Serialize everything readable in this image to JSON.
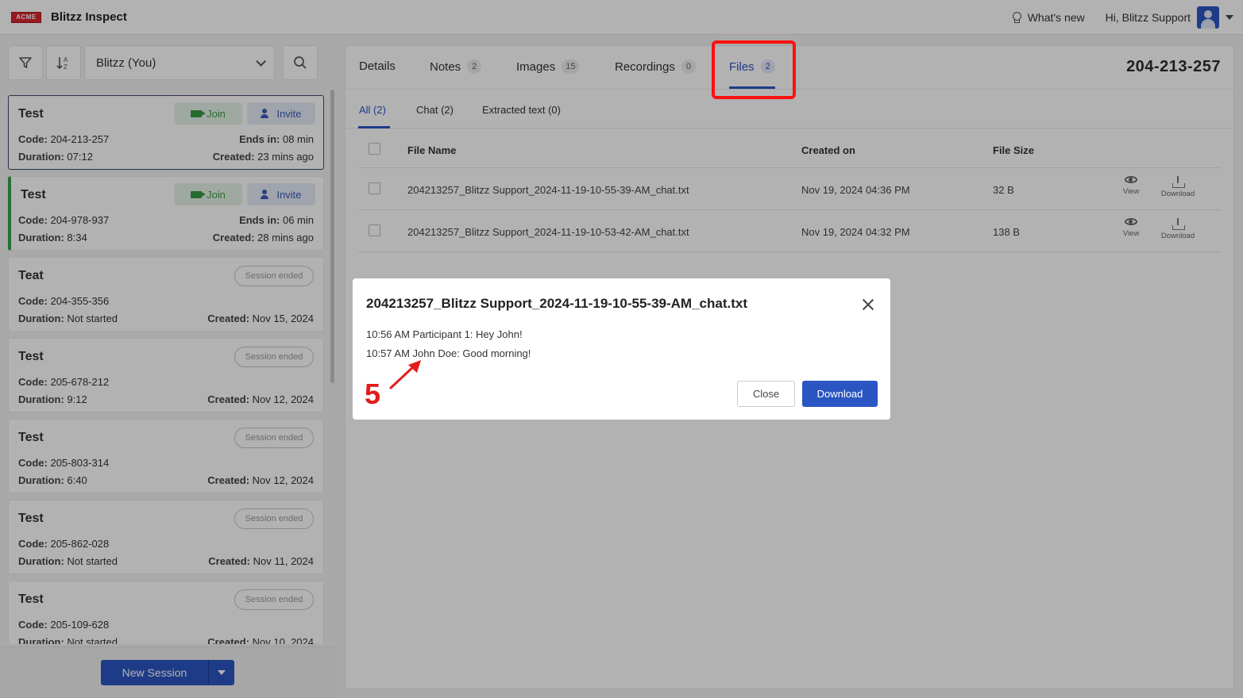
{
  "app": {
    "logo_text": "ACME",
    "title": "Blitzz Inspect",
    "whats_new": "What's new",
    "greeting": "Hi, Blitzz Support"
  },
  "sidebar": {
    "owner_filter": "Blitzz (You)",
    "sessions": [
      {
        "title": "Test",
        "code": "204-213-257",
        "duration": "07:12",
        "ends_in": "08 min",
        "created": "23 mins ago",
        "join": "Join",
        "invite": "Invite"
      },
      {
        "title": "Test",
        "code": "204-978-937",
        "duration": "8:34",
        "ends_in": "06 min",
        "created": "28 mins ago",
        "join": "Join",
        "invite": "Invite"
      },
      {
        "title": "Teat",
        "code": "204-355-356",
        "duration": "Not started",
        "created": "Nov 15, 2024",
        "status": "Session ended"
      },
      {
        "title": "Test",
        "code": "205-678-212",
        "duration": "9:12",
        "created": "Nov 12, 2024",
        "status": "Session ended"
      },
      {
        "title": "Test",
        "code": "205-803-314",
        "duration": "6:40",
        "created": "Nov 12, 2024",
        "status": "Session ended"
      },
      {
        "title": "Test",
        "code": "205-862-028",
        "duration": "Not started",
        "created": "Nov 11, 2024",
        "status": "Session ended"
      },
      {
        "title": "Test",
        "code": "205-109-628",
        "duration": "Not started",
        "created": "Nov 10, 2024",
        "status": "Session ended"
      }
    ],
    "labels": {
      "code": "Code:",
      "duration": "Duration:",
      "ends_in": "Ends in:",
      "created": "Created:"
    },
    "new_session": "New Session"
  },
  "main": {
    "tabs": [
      {
        "label": "Details"
      },
      {
        "label": "Notes",
        "count": "2"
      },
      {
        "label": "Images",
        "count": "15"
      },
      {
        "label": "Recordings",
        "count": "0"
      },
      {
        "label": "Files",
        "count": "2"
      }
    ],
    "session_code": "204-213-257",
    "subtabs": [
      "All (2)",
      "Chat (2)",
      "Extracted text (0)"
    ],
    "table": {
      "headers": [
        "File Name",
        "Created on",
        "File Size"
      ],
      "rows": [
        {
          "name": "204213257_Blitzz Support_2024-11-19-10-55-39-AM_chat.txt",
          "created": "Nov 19, 2024 04:36 PM",
          "size": "32 B"
        },
        {
          "name": "204213257_Blitzz Support_2024-11-19-10-53-42-AM_chat.txt",
          "created": "Nov 19, 2024 04:32 PM",
          "size": "138 B"
        }
      ],
      "view_label": "View",
      "download_label": "Download"
    }
  },
  "modal": {
    "title": "204213257_Blitzz Support_2024-11-19-10-55-39-AM_chat.txt",
    "lines": [
      "10:56 AM Participant 1: Hey John!",
      "10:57 AM John Doe: Good morning!"
    ],
    "close": "Close",
    "download": "Download"
  },
  "annotation": {
    "step": "5"
  },
  "colors": {
    "accent": "#2b55c2",
    "annotation_red": "#ff0f0f",
    "join_green": "#3a9a46"
  }
}
